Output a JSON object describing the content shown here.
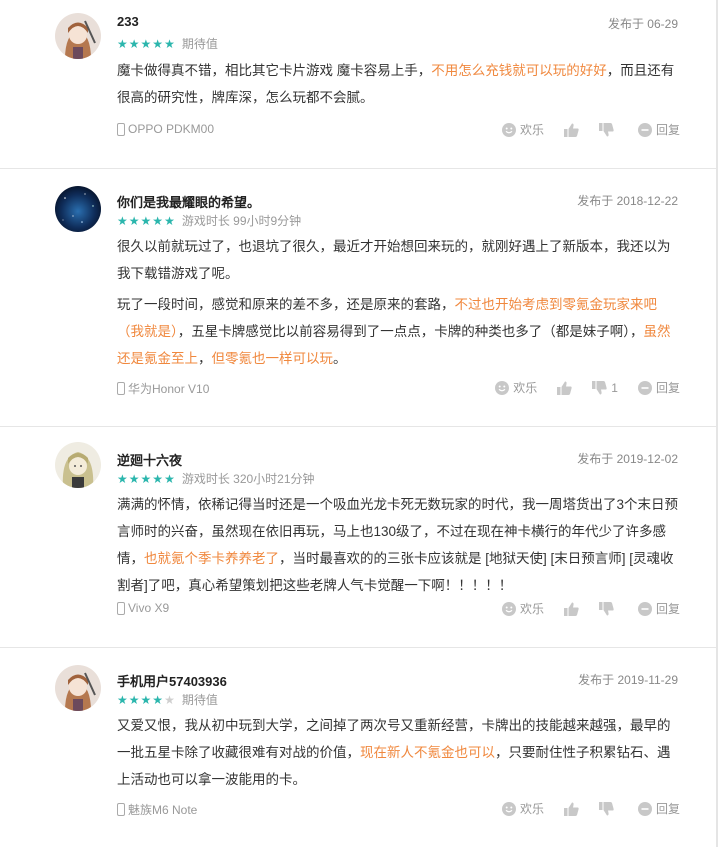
{
  "colors": {
    "accent": "#2bb6ad",
    "highlight": "#f0883e"
  },
  "labels": {
    "fun": "欢乐",
    "reply": "回复"
  },
  "reviews": [
    {
      "username": "233",
      "date": "发布于 06-29",
      "rating": 5,
      "meta": "期待值",
      "paragraphs": [
        [
          {
            "t": "魔卡做得真不错，相比其它卡片游戏 魔卡容易上手，",
            "h": false
          },
          {
            "t": "不用怎么充钱就可以玩的好好",
            "h": true
          },
          {
            "t": "，而且还有很高的研究性，牌库深，怎么玩都不会腻。",
            "h": false
          }
        ]
      ],
      "device": "OPPO PDKM00",
      "dislike_count": ""
    },
    {
      "username": "你们是我最耀眼的希望。",
      "date": "发布于 2018-12-22",
      "rating": 5,
      "meta": "游戏时长 99小时9分钟",
      "paragraphs": [
        [
          {
            "t": "很久以前就玩过了，也退坑了很久，最近才开始想回来玩的，就刚好遇上了新版本，我还以为我下载错游戏了呢。",
            "h": false
          }
        ],
        [
          {
            "t": "玩了一段时间，感觉和原来的差不多，还是原来的套路，",
            "h": false
          },
          {
            "t": "不过也开始考虑到零氪金玩家来吧（我就是）",
            "h": true
          },
          {
            "t": "，五星卡牌感觉比以前容易得到了一点点，卡牌的种类也多了（都是妹子啊），",
            "h": false
          },
          {
            "t": "虽然还是氪金至上",
            "h": true
          },
          {
            "t": "，",
            "h": false
          },
          {
            "t": "但零氪也一样可以玩",
            "h": true
          },
          {
            "t": "。",
            "h": false
          }
        ]
      ],
      "device": "华为Honor V10",
      "dislike_count": "1"
    },
    {
      "username": "逆廻十六夜",
      "date": "发布于 2019-12-02",
      "rating": 5,
      "meta": "游戏时长 320小时21分钟",
      "paragraphs": [
        [
          {
            "t": "满满的怀情，依稀记得当时还是一个吸血光龙卡死无数玩家的时代，我一周塔货出了3个末日预言师时的兴奋，虽然现在依旧再玩，马上也130级了，不过在现在神卡横行的年代少了许多感情，",
            "h": false
          },
          {
            "t": "也就氪个季卡养养老了",
            "h": true
          },
          {
            "t": "，当时最喜欢的的三张卡应该就是 [地狱天使] [末日预言师] [灵魂收割者]了吧，真心希望策划把这些老牌人气卡觉醒一下啊！！！！！",
            "h": false
          }
        ]
      ],
      "device": "Vivo X9",
      "dislike_count": ""
    },
    {
      "username": "手机用户57403936",
      "date": "发布于 2019-11-29",
      "rating": 4,
      "meta": "期待值",
      "paragraphs": [
        [
          {
            "t": "又爱又恨，我从初中玩到大学，之间掉了两次号又重新经营，卡牌出的技能越来越强，最早的一批五星卡除了收藏很难有对战的价值，",
            "h": false
          },
          {
            "t": "现在新人不氪金也可以",
            "h": true
          },
          {
            "t": "，只要耐住性子积累钻石、遇上活动也可以拿一波能用的卡。",
            "h": false
          }
        ]
      ],
      "device": "魅族M6 Note",
      "dislike_count": ""
    }
  ]
}
